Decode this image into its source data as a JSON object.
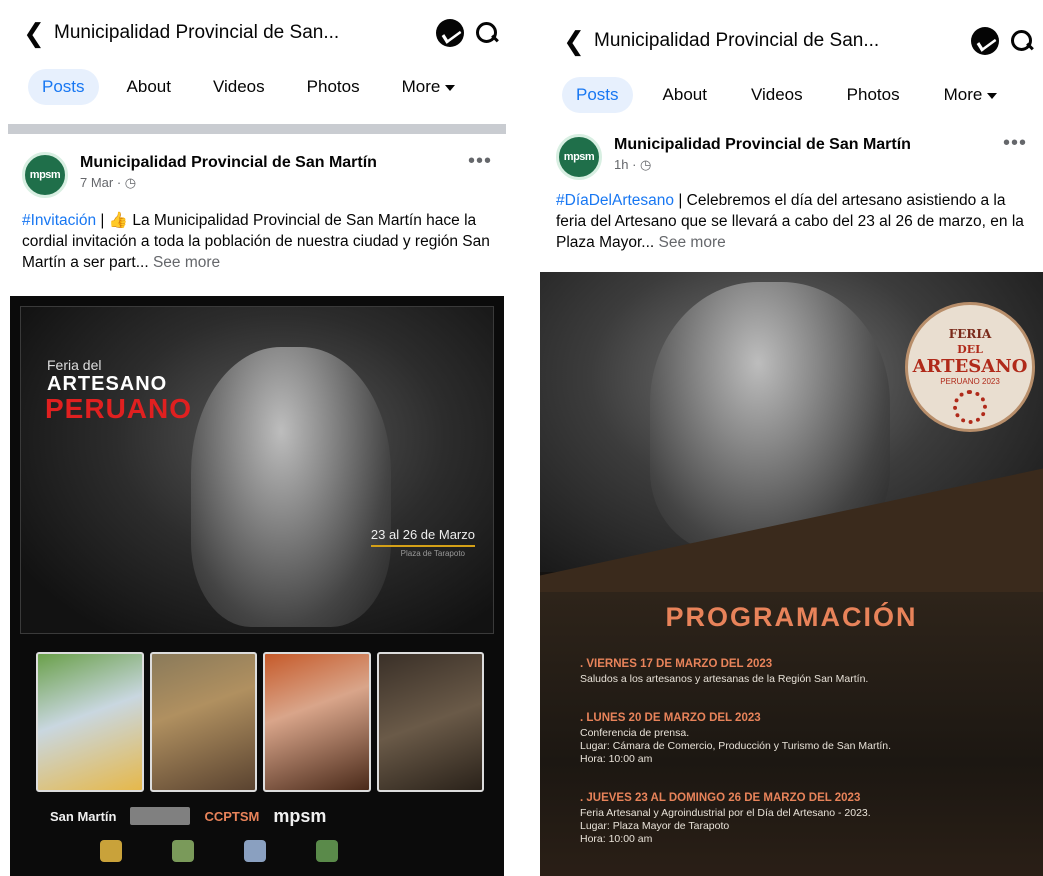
{
  "colors": {
    "accent": "#1877f2",
    "tab_bg": "#e7f0fd",
    "programacion": "#e8835a",
    "poster_red": "#e02020"
  },
  "left": {
    "topbar": {
      "back_icon": "chevron-left-icon",
      "title": "Municipalidad Provincial de San...",
      "icons": [
        "messenger-icon",
        "search-icon"
      ]
    },
    "tabs": [
      {
        "label": "Posts",
        "active": true
      },
      {
        "label": "About"
      },
      {
        "label": "Videos"
      },
      {
        "label": "Photos"
      },
      {
        "label": "More"
      }
    ],
    "post": {
      "avatar": "mpsm",
      "page_name": "Municipalidad Provincial de San Martín",
      "meta": "7 Mar · ◷",
      "text_hashtag": "#Invitación",
      "text_body": " | 👍 La Municipalidad Provincial de San Martín hace la cordial invitación a toda la población de nuestra ciudad y región San Martín a ser part...",
      "see_more": "See more",
      "more": "•••",
      "poster": {
        "small": "Feria del",
        "big": "ARTESANO",
        "red": "PERUANO",
        "date": "23 al 26 de Marzo",
        "date_sub": "Plaza de Tarapoto",
        "logos": [
          "San Martín",
          "CCPTSM",
          "mpsm"
        ]
      }
    }
  },
  "right": {
    "topbar": {
      "back_icon": "chevron-left-icon",
      "title": "Municipalidad Provincial de San...",
      "icons": [
        "messenger-icon",
        "search-icon"
      ]
    },
    "tabs": [
      {
        "label": "Posts",
        "active": true
      },
      {
        "label": "About"
      },
      {
        "label": "Videos"
      },
      {
        "label": "Photos"
      },
      {
        "label": "More"
      }
    ],
    "post": {
      "avatar": "mpsm",
      "page_name": "Municipalidad Provincial de San Martín",
      "meta": "1h · ◷",
      "text_hashtag": "#DíaDelArtesano",
      "text_body": " | Celebremos el día del artesano asistiendo a la feria del Artesano que se llevará a cabo del 23 al 26 de marzo, en la Plaza Mayor...",
      "see_more": "See more",
      "more": "•••",
      "badge": {
        "line1": "FERIA",
        "line2": "DEL",
        "line3": "ARTESANO",
        "line4": "PERUANO 2023"
      },
      "programacion": "PROGRAMACIÓN",
      "events": [
        {
          "day": ". VIERNES 17 DE MARZO DEL 2023",
          "l1": "Saludos a los artesanos y artesanas de la Región San Martín.",
          "l2": "",
          "l3": ""
        },
        {
          "day": ". LUNES 20 DE MARZO DEL 2023",
          "l1": "Conferencia de prensa.",
          "l2": "Lugar: Cámara de Comercio, Producción y Turismo de San Martín.",
          "l3": "Hora: 10:00 am"
        },
        {
          "day": ". JUEVES 23 AL DOMINGO 26 DE MARZO DEL 2023",
          "l1": "Feria Artesanal y Agroindustrial por el Día del Artesano - 2023.",
          "l2": "Lugar: Plaza Mayor de Tarapoto",
          "l3": "Hora: 10:00 am"
        }
      ]
    }
  }
}
